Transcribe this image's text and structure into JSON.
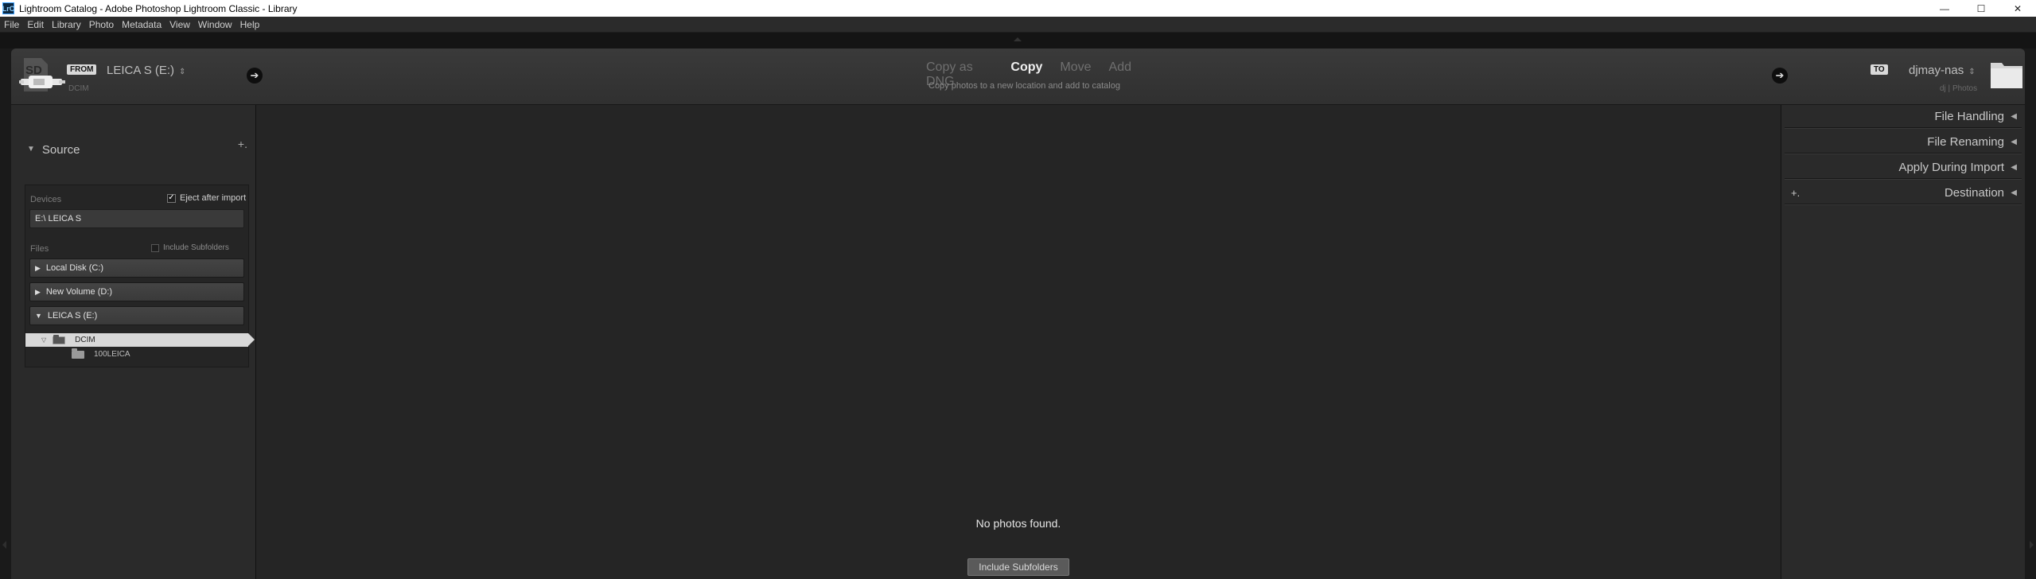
{
  "window": {
    "title": "Lightroom Catalog - Adobe Photoshop Lightroom Classic - Library",
    "app_icon_text": "LrC",
    "controls": [
      "—",
      "☐",
      "✕"
    ]
  },
  "menu": [
    "File",
    "Edit",
    "Library",
    "Photo",
    "Metadata",
    "View",
    "Window",
    "Help"
  ],
  "header": {
    "from_label": "FROM",
    "source_name": "LEICA S (E:)",
    "source_sub": "DCIM",
    "modes": [
      {
        "label": "Copy as DNG",
        "active": false
      },
      {
        "label": "Copy",
        "active": true
      },
      {
        "label": "Move",
        "active": false
      },
      {
        "label": "Add",
        "active": false
      }
    ],
    "mode_description": "Copy photos to a new location and add to catalog",
    "to_label": "TO",
    "dest_name": "djmay-nas",
    "dest_sub": "dj | Photos",
    "sd_icon": "sd-card-icon",
    "dest_icon": "folder-icon"
  },
  "source_panel": {
    "title": "Source",
    "devices_label": "Devices",
    "eject_label": "Eject after import",
    "eject_checked": true,
    "device_name": "E:\\ LEICA S",
    "files_label": "Files",
    "include_subfolders_label": "Include Subfolders",
    "include_subfolders_checked": false,
    "volumes": [
      {
        "label": "Local Disk (C:)",
        "expanded": false
      },
      {
        "label": "New Volume (D:)",
        "expanded": false
      },
      {
        "label": "LEICA S (E:)",
        "expanded": true
      }
    ],
    "folders": [
      {
        "label": "DCIM",
        "selected": true
      },
      {
        "label": "100LEICA",
        "selected": false
      }
    ]
  },
  "center": {
    "empty_message": "No photos found.",
    "include_subfolders_button": "Include Subfolders"
  },
  "right_panel": {
    "sections": [
      "File Handling",
      "File Renaming",
      "Apply During Import",
      "Destination"
    ]
  }
}
